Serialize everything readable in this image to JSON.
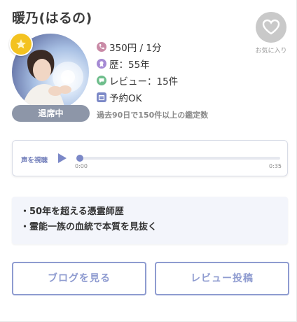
{
  "profile": {
    "name": "暖乃(はるの)",
    "status": "退席中"
  },
  "favorite": {
    "label": "お気に入り"
  },
  "info": {
    "price": "350円 / 1分",
    "career": "歴：55年",
    "reviews": "レビュー：15件",
    "reservation": "予約OK",
    "note": "過去90日で150件以上の鑑定数"
  },
  "player": {
    "label": "声を視聴",
    "time_start": "0:00",
    "time_end": "0:35",
    "progress": 0
  },
  "features": [
    "・50年を超える憑霊師歴",
    "・霊能一族の血統で本質を見抜く"
  ],
  "buttons": {
    "blog": "ブログを見る",
    "review": "レビュー投稿"
  },
  "colors": {
    "accent": "#8e9bd0",
    "status_pill": "#8d96a8",
    "star_badge": "#f3c220",
    "phone_icon": "#c98aa6",
    "career_icon": "#a58ad4",
    "review_icon": "#6fbe8c",
    "reserve_icon": "#7b88c7"
  },
  "icons": {
    "favorite": "heart-icon",
    "rank": "star-icon",
    "price": "phone-icon",
    "career": "medal-icon",
    "reviews": "chat-icon",
    "reservation": "calendar-icon",
    "play": "play-icon"
  }
}
